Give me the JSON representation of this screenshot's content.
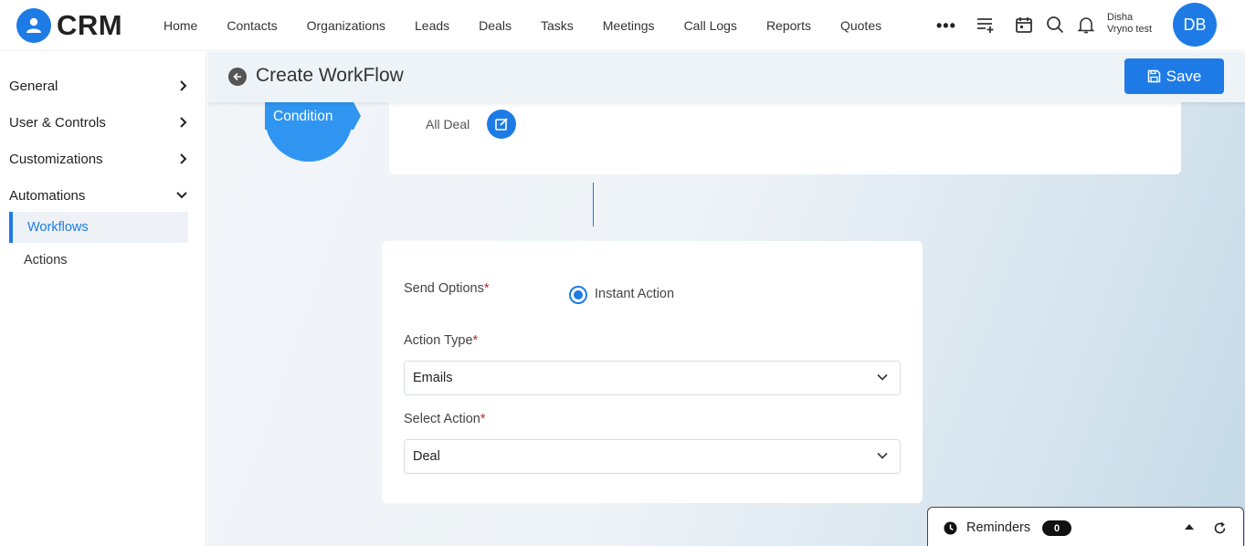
{
  "app": {
    "name": "CRM",
    "nav": [
      "Home",
      "Contacts",
      "Organizations",
      "Leads",
      "Deals",
      "Tasks",
      "Meetings",
      "Call Logs",
      "Reports",
      "Quotes"
    ],
    "more": "•••",
    "user": {
      "first": "Disha",
      "second": "Vryno test",
      "initials": "DB"
    },
    "icons": [
      "more-icon",
      "add-list-icon",
      "calendar-icon",
      "search-icon",
      "bell-icon"
    ]
  },
  "sidebar": {
    "sections": [
      {
        "label": "General",
        "expanded": false
      },
      {
        "label": "User & Controls",
        "expanded": false
      },
      {
        "label": "Customizations",
        "expanded": false
      },
      {
        "label": "Automations",
        "expanded": true
      }
    ],
    "sub_items": [
      {
        "label": "Workflows",
        "active": true
      },
      {
        "label": "Actions",
        "active": false
      }
    ]
  },
  "page": {
    "title": "Create WorkFlow",
    "save_label": "Save",
    "condition": {
      "label": "Condition",
      "value": "All Deal"
    },
    "action_form": {
      "send_options_label": "Send Options",
      "send_option_selected": "Instant Action",
      "action_type_label": "Action Type",
      "action_type_value": "Emails",
      "select_action_label": "Select Action",
      "select_action_value": "Deal",
      "required_mark": "*"
    }
  },
  "reminders": {
    "label": "Reminders",
    "count": "0"
  },
  "colors": {
    "primary": "#1e7be6",
    "condition": "#2f95f0",
    "required": "#c0262d"
  }
}
